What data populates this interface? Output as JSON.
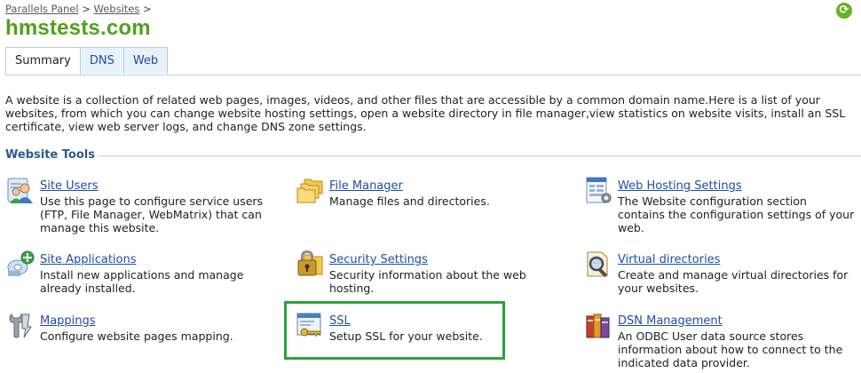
{
  "breadcrumb": {
    "items": [
      "Parallels Panel",
      "Websites"
    ],
    "separator": ">"
  },
  "page": {
    "title": "hmstests.com",
    "title_color": "#4fa21a",
    "intro": "A website is a collection of related web pages, images, videos, and other files that are accessible by a common domain name.Here is a list of your websites, from which you can change website hosting settings, open a website directory in file manager,view statistics on website visits, install an SSL certificate, view web server logs, and change DNS zone settings."
  },
  "topbar": {
    "refresh_icon": "refresh-icon",
    "refresh_glyph": "⟳"
  },
  "tabs": [
    {
      "label": "Summary",
      "active": true
    },
    {
      "label": "DNS",
      "active": false
    },
    {
      "label": "Web",
      "active": false
    }
  ],
  "section": {
    "title": "Website Tools"
  },
  "tools": [
    {
      "name": "Site Users",
      "desc": "Use this page to configure service users (FTP, File Manager, WebMatrix) that can manage this website.",
      "icon": "users-icon"
    },
    {
      "name": "File Manager",
      "desc": "Manage files and directories.",
      "icon": "folders-icon"
    },
    {
      "name": "Web Hosting Settings",
      "desc": "The Website configuration section contains the configuration settings of your web.",
      "icon": "settings-page-icon"
    },
    {
      "name": "Site Applications",
      "desc": "Install new applications and manage already installed.",
      "icon": "add-application-icon"
    },
    {
      "name": "Security Settings",
      "desc": "Security information about the web hosting.",
      "icon": "lock-folder-icon"
    },
    {
      "name": "Virtual directories",
      "desc": "Create and manage virtual directories for your websites.",
      "icon": "magnifier-page-icon"
    },
    {
      "name": "Mappings",
      "desc": "Configure website pages mapping.",
      "icon": "wrench-icon"
    },
    {
      "name": "SSL",
      "desc": "Setup SSL for your website.",
      "icon": "certificate-key-icon"
    },
    {
      "name": "DSN Management",
      "desc": "An ODBC User data source stores information about how to connect to the indicated data provider.",
      "icon": "database-books-icon"
    }
  ],
  "highlight": {
    "target": "SSL",
    "color": "#2aa33a"
  }
}
